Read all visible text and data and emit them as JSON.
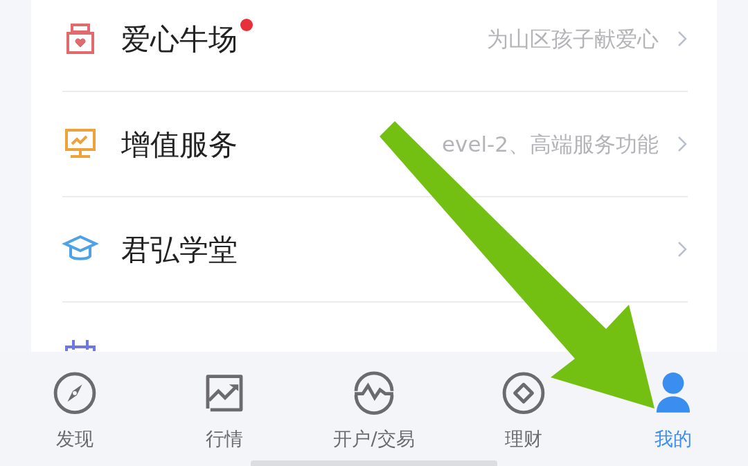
{
  "menu_items": [
    {
      "title": "爱心牛场",
      "badge": true,
      "subtitle": "为山区孩子献爱心"
    },
    {
      "title": "增值服务",
      "badge": false,
      "subtitle": "evel-2、高端服务功能"
    },
    {
      "title": "君弘学堂",
      "badge": false
    }
  ],
  "tab_bar": [
    {
      "label": "发现",
      "selected": false
    },
    {
      "label": "行情",
      "selected": false
    },
    {
      "label": "开户/交易",
      "selected": false
    },
    {
      "label": "理财",
      "selected": false
    },
    {
      "label": "我的",
      "selected": true
    }
  ]
}
